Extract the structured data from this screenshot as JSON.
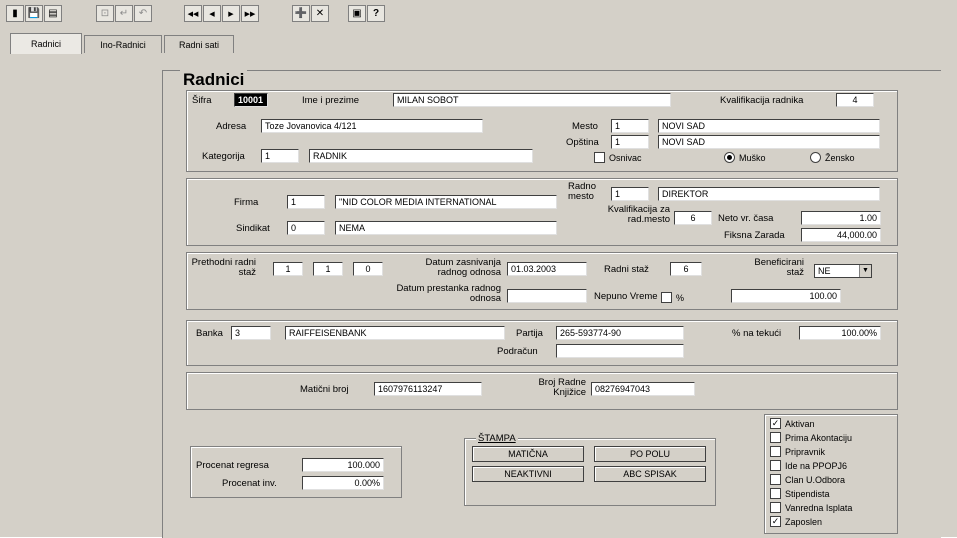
{
  "toolbar": {
    "group1": [
      "▮",
      "💾",
      "▤"
    ],
    "group2": [
      "⊡",
      "↵",
      "↶"
    ],
    "nav": [
      "◀◀",
      "◀",
      "▶",
      "▶▶"
    ],
    "group4": [
      "➕",
      "✕"
    ],
    "group5": [
      "▣",
      "?"
    ]
  },
  "tabs": [
    {
      "label": "Radnici"
    },
    {
      "label": "Ino-Radnici"
    },
    {
      "label": "Radni sati"
    }
  ],
  "group_title": "Radnici",
  "person": {
    "sifra_label": "Šifra",
    "sifra": "10001",
    "ime_label": "Ime i prezime",
    "ime": "MILAN SOBOT",
    "kval_label": "Kvalifikacija radnika",
    "kval": "4",
    "adresa_label": "Adresa",
    "adresa": "Toze Jovanovica 4/121",
    "mesto_label": "Mesto",
    "mesto_code": "1",
    "mesto": "NOVI SAD",
    "opstina_label": "Opština",
    "opstina_code": "1",
    "opstina": "NOVI SAD",
    "kategorija_label": "Kategorija",
    "kategorija_code": "1",
    "kategorija": "RADNIK",
    "osnivac_label": "Osnivac",
    "muski_label": "Muško",
    "zenski_label": "Žensko"
  },
  "firm": {
    "firma_label": "Firma",
    "firma_code": "1",
    "firma": "\"NID COLOR MEDIA INTERNATIONAL",
    "radno_mesto_label": "Radno mesto",
    "radno_mesto_code": "1",
    "radno_mesto": "DIREKTOR",
    "sindikat_label": "Sindikat",
    "sindikat_code": "0",
    "sindikat": "NEMA",
    "kval_rm_label": "Kvalifikacija za rad.mesto",
    "kval_rm": "6",
    "neto_label": "Neto vr. časa",
    "neto": "1.00",
    "fiksna_label": "Fiksna Zarada",
    "fiksna": "44,000.00"
  },
  "staz": {
    "prethodni_label": "Prethodni radni staž",
    "p1": "1",
    "p2": "1",
    "p3": "0",
    "datum_zasn_label": "Datum zasnivanja radnog odnosa",
    "datum_zasn": "01.03.2003",
    "radni_staz_label": "Radni staž",
    "radni_staz": "6",
    "benef_label": "Beneficirani staž",
    "benef": "NE",
    "datum_prest_label": "Datum prestanka radnog odnosa",
    "datum_prest": "",
    "nepuno_label": "Nepuno Vreme",
    "pct_label": "%",
    "nepuno": "100.00"
  },
  "bank": {
    "banka_label": "Banka",
    "banka_code": "3",
    "banka": "RAIFFEISENBANK",
    "partija_label": "Partija",
    "partija": "265-593774-90",
    "pct_tek_label": "% na tekući",
    "pct_tek": "100.00%",
    "podracun_label": "Podračun",
    "podracun": ""
  },
  "ids": {
    "mat_label": "Matični broj",
    "mat": "1607976113247",
    "knjizica_label": "Broj Radne Knjižice",
    "knjizica": "08276947043"
  },
  "regres": {
    "regres_label": "Procenat regresa",
    "regres": "100.000",
    "inv_label": "Procenat inv.",
    "inv": "0.00%"
  },
  "stampa": {
    "title": "ŠTAMPA",
    "btn1": "MATIČNA",
    "btn2": "PO POLU",
    "btn3": "NEAKTIVNI",
    "btn4": "ABC SPISAK"
  },
  "flags": [
    {
      "label": "Aktivan",
      "checked": true
    },
    {
      "label": "Prima Akontaciju",
      "checked": false
    },
    {
      "label": "Pripravnik",
      "checked": false
    },
    {
      "label": "Ide na PPOPJ6",
      "checked": false
    },
    {
      "label": "Clan U.Odbora",
      "checked": false
    },
    {
      "label": "Stipendista",
      "checked": false
    },
    {
      "label": "Vanredna Isplata",
      "checked": false
    },
    {
      "label": "Zaposlen",
      "checked": true
    }
  ]
}
